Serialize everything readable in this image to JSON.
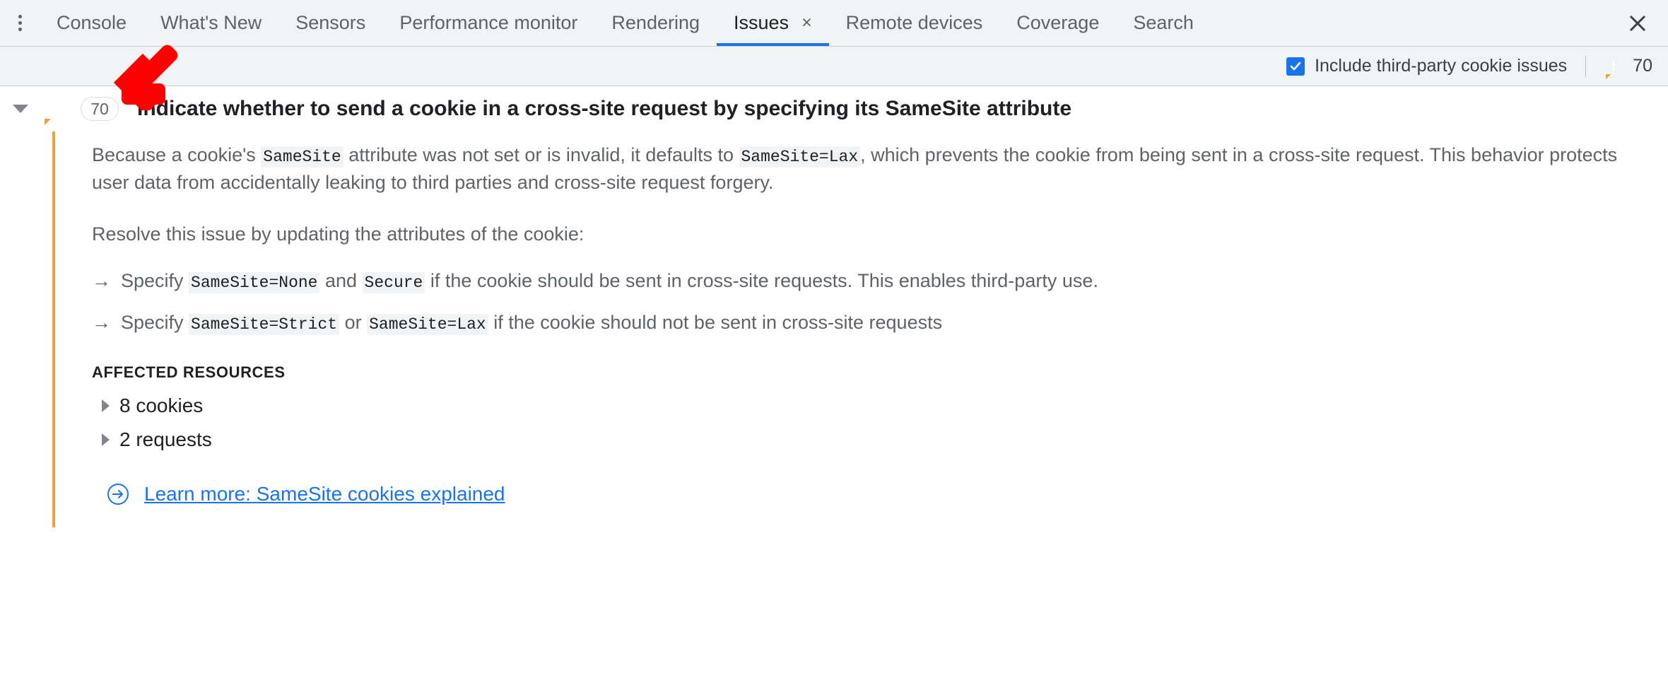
{
  "tabbar": {
    "more_tooltip": "More tabs",
    "tabs": [
      {
        "label": "Console",
        "active": false
      },
      {
        "label": "What's New",
        "active": false
      },
      {
        "label": "Sensors",
        "active": false
      },
      {
        "label": "Performance monitor",
        "active": false
      },
      {
        "label": "Rendering",
        "active": false
      },
      {
        "label": "Issues",
        "active": true
      },
      {
        "label": "Remote devices",
        "active": false
      },
      {
        "label": "Coverage",
        "active": false
      },
      {
        "label": "Search",
        "active": false
      }
    ],
    "issues_tab_close": "×",
    "panel_close": "×"
  },
  "toolbar": {
    "checkbox_label": "Include third-party cookie issues",
    "checkbox_checked": true,
    "warning_count": "70",
    "warning_icon": "warning-bubble-icon",
    "accent_blue": "#1a73e8",
    "warning_orange": "#e9a33a"
  },
  "issue": {
    "expanded": true,
    "severity_icon": "warning-bubble-icon",
    "count_badge": "70",
    "title": "Indicate whether to send a cookie in a cross-site request by specifying its SameSite attribute",
    "paragraph1": {
      "part1": "Because a cookie's ",
      "code1": "SameSite",
      "part2": " attribute was not set or is invalid, it defaults to ",
      "code2": "SameSite=Lax",
      "part3": ", which prevents the cookie from being sent in a cross-site request. This behavior protects user data from accidentally leaking to third parties and cross-site request forgery."
    },
    "paragraph2": "Resolve this issue by updating the attributes of the cookie:",
    "bullets": [
      {
        "marker": "→",
        "part1": "Specify ",
        "code1": "SameSite=None",
        "part2": " and ",
        "code2": "Secure",
        "part3": " if the cookie should be sent in cross-site requests. This enables third-party use."
      },
      {
        "marker": "→",
        "part1": "Specify ",
        "code1": "SameSite=Strict",
        "part2": " or ",
        "code2": "SameSite=Lax",
        "part3": " if the cookie should not be sent in cross-site requests"
      }
    ],
    "affected_resources_label": "AFFECTED RESOURCES",
    "resources": [
      {
        "label": "8 cookies",
        "expanded": false
      },
      {
        "label": "2 requests",
        "expanded": false
      }
    ],
    "learn_more": {
      "icon": "arrow-in-circle-icon",
      "text": "Learn more: SameSite cookies explained"
    },
    "stripe_color": "#e9a33a"
  },
  "annotation": {
    "arrow_color": "#ff0000",
    "arrow_direction": "down-left"
  }
}
